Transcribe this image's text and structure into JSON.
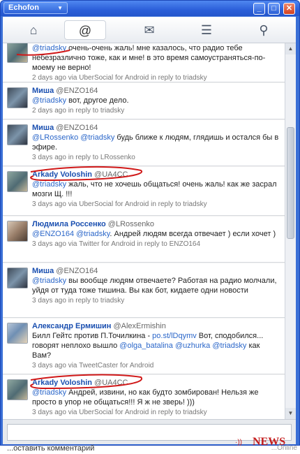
{
  "window": {
    "app_menu_label": "Echofon",
    "caret": "▼",
    "minimize": "_",
    "maximize": "□",
    "close": "✕"
  },
  "toolbar": {
    "home_icon": "⌂",
    "mentions_icon": "@",
    "messages_icon": "✉",
    "lists_icon": "☰",
    "search_icon": "⚲"
  },
  "tweets": [
    {
      "name": "",
      "handle": "",
      "mention": "@triadsky",
      "text": " очень-очень жаль! мне казалось, что радио тебе небезразлично тоже, как и мне! в это время самоустраняться-по-моему не верно!",
      "meta": "2 days ago via UberSocial for Android in reply to triadsky"
    },
    {
      "name": "Миша",
      "handle": "@ENZO164",
      "mention": "@triadsky",
      "text": " вот, другое дело.",
      "meta": "2 days ago in reply to triadsky"
    },
    {
      "name": "Миша",
      "handle": "@ENZO164",
      "mention": "@LRossenko @triadsky",
      "text": " будь ближе к людям, глядишь и остался бы в эфире.",
      "meta": "3 days ago in reply to LRossenko"
    },
    {
      "name": "Arkady Voloshin",
      "handle": "@UA4CC",
      "mention": "@triadsky",
      "text": " жаль, что не хочешь общаться! очень жаль! как же засрал мозги Щ. !!!",
      "meta": "3 days ago via UberSocial for Android in reply to triadsky"
    },
    {
      "name": "Людмила Россенко",
      "handle": "@LRossenko",
      "mention": "@ENZO164 @triadsky",
      "text": ". Андрей людям всегда отвечает ) если хочет )",
      "meta": "3 days ago via Twitter for Android in reply to ENZO164"
    },
    {
      "name": "Миша",
      "handle": "@ENZO164",
      "mention": "@triadsky",
      "text": " вы вообще людям отвечаете? Работая на радио молчали, уйдя от туда тоже тишина. Вы как бот, кидаете одни новости",
      "meta": "3 days ago in reply to triadsky"
    },
    {
      "name": "Александр Ермишин",
      "handle": "@AlexErmishin",
      "text_a": "Билл Гейтс против П.Точилкина - ",
      "link": "po.st/lDqymv",
      "text_b": " Вот, сподобился... говорят неплохо вышло ",
      "mention_a": "@olga_batalina",
      "mention_b": "@uzhurka @triadsky",
      "text_c": " как Вам?",
      "meta": "3 days ago via TweetCaster for Android"
    },
    {
      "name": "Arkady Voloshin",
      "handle": "@UA4CC",
      "mention": "@triadsky",
      "text": " Андрей, извини, но как будто зомбирован! Нельзя же просто в упор не общаться!!! Я ж не зверь! )))",
      "meta": "3 days ago via UberSocial for Android in reply to triadsky"
    }
  ],
  "compose": {
    "value": ""
  },
  "bottom": {
    "leak_text": "...оставить комментарий",
    "leak_right": "...Online",
    "news_label": "NEWS",
    "news_dot": "·))"
  }
}
